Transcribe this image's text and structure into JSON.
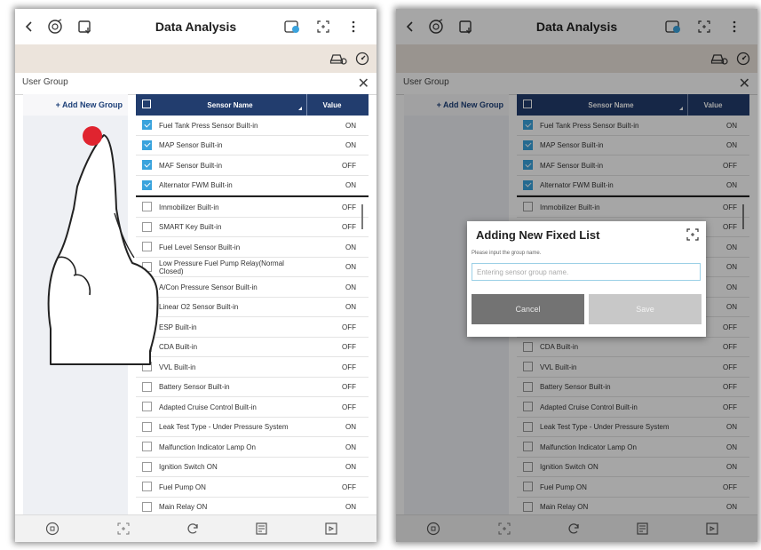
{
  "app": {
    "title": "Data Analysis"
  },
  "user_group": {
    "title": "User Group",
    "close": "✕",
    "add_group_label": "+ Add New Group"
  },
  "table": {
    "headers": {
      "name": "Sensor Name",
      "value": "Value"
    },
    "rows": [
      {
        "name": "Fuel Tank Press Sensor Built-in",
        "value": "ON",
        "checked": true
      },
      {
        "name": "MAP Sensor Built-in",
        "value": "ON",
        "checked": true
      },
      {
        "name": "MAF Sensor Built-in",
        "value": "OFF",
        "checked": true
      },
      {
        "name": "Alternator FWM Built-in",
        "value": "ON",
        "checked": true
      },
      {
        "name": "Immobilizer Built-in",
        "value": "OFF",
        "checked": false
      },
      {
        "name": "SMART Key Built-in",
        "value": "OFF",
        "checked": false
      },
      {
        "name": "Fuel Level Sensor Built-in",
        "value": "ON",
        "checked": false
      },
      {
        "name": "Low Pressure Fuel Pump Relay(Normal Closed)",
        "value": "ON",
        "checked": false
      },
      {
        "name": "A/Con Pressure Sensor Built-in",
        "value": "ON",
        "checked": false
      },
      {
        "name": "Linear O2 Sensor Built-in",
        "value": "ON",
        "checked": false
      },
      {
        "name": "ESP Built-in",
        "value": "OFF",
        "checked": false
      },
      {
        "name": "CDA Built-in",
        "value": "OFF",
        "checked": false
      },
      {
        "name": "VVL Built-in",
        "value": "OFF",
        "checked": false
      },
      {
        "name": "Battery Sensor Built-in",
        "value": "OFF",
        "checked": false
      },
      {
        "name": "Adapted Cruise Control Built-in",
        "value": "OFF",
        "checked": false
      },
      {
        "name": "Leak Test Type - Under Pressure System",
        "value": "ON",
        "checked": false
      },
      {
        "name": "Malfunction Indicator Lamp On",
        "value": "ON",
        "checked": false
      },
      {
        "name": "Ignition Switch ON",
        "value": "ON",
        "checked": false
      },
      {
        "name": "Fuel Pump ON",
        "value": "OFF",
        "checked": false
      },
      {
        "name": "Main Relay ON",
        "value": "ON",
        "checked": false
      }
    ]
  },
  "dialog": {
    "title": "Adding New Fixed List",
    "label": "Please input the group name.",
    "placeholder": "Entering sensor group name.",
    "cancel": "Cancel",
    "save": "Save"
  },
  "icons": {
    "back": "chevron-left-icon",
    "vehicle": "vehicle-icon",
    "export": "export-icon",
    "record": "record-icon",
    "fullscreen": "fullscreen-icon",
    "more": "more-vert-icon",
    "car-settings": "car-settings-icon",
    "gauge": "gauge-icon",
    "home": "home-icon",
    "refresh": "refresh-icon",
    "list": "list-icon",
    "save": "save-file-icon"
  },
  "colors": {
    "header_bg": "#223d6e",
    "checkbox_checked": "#3aa3dd",
    "subbar_bg": "#ece4dc",
    "touch_point": "#e0242f"
  }
}
